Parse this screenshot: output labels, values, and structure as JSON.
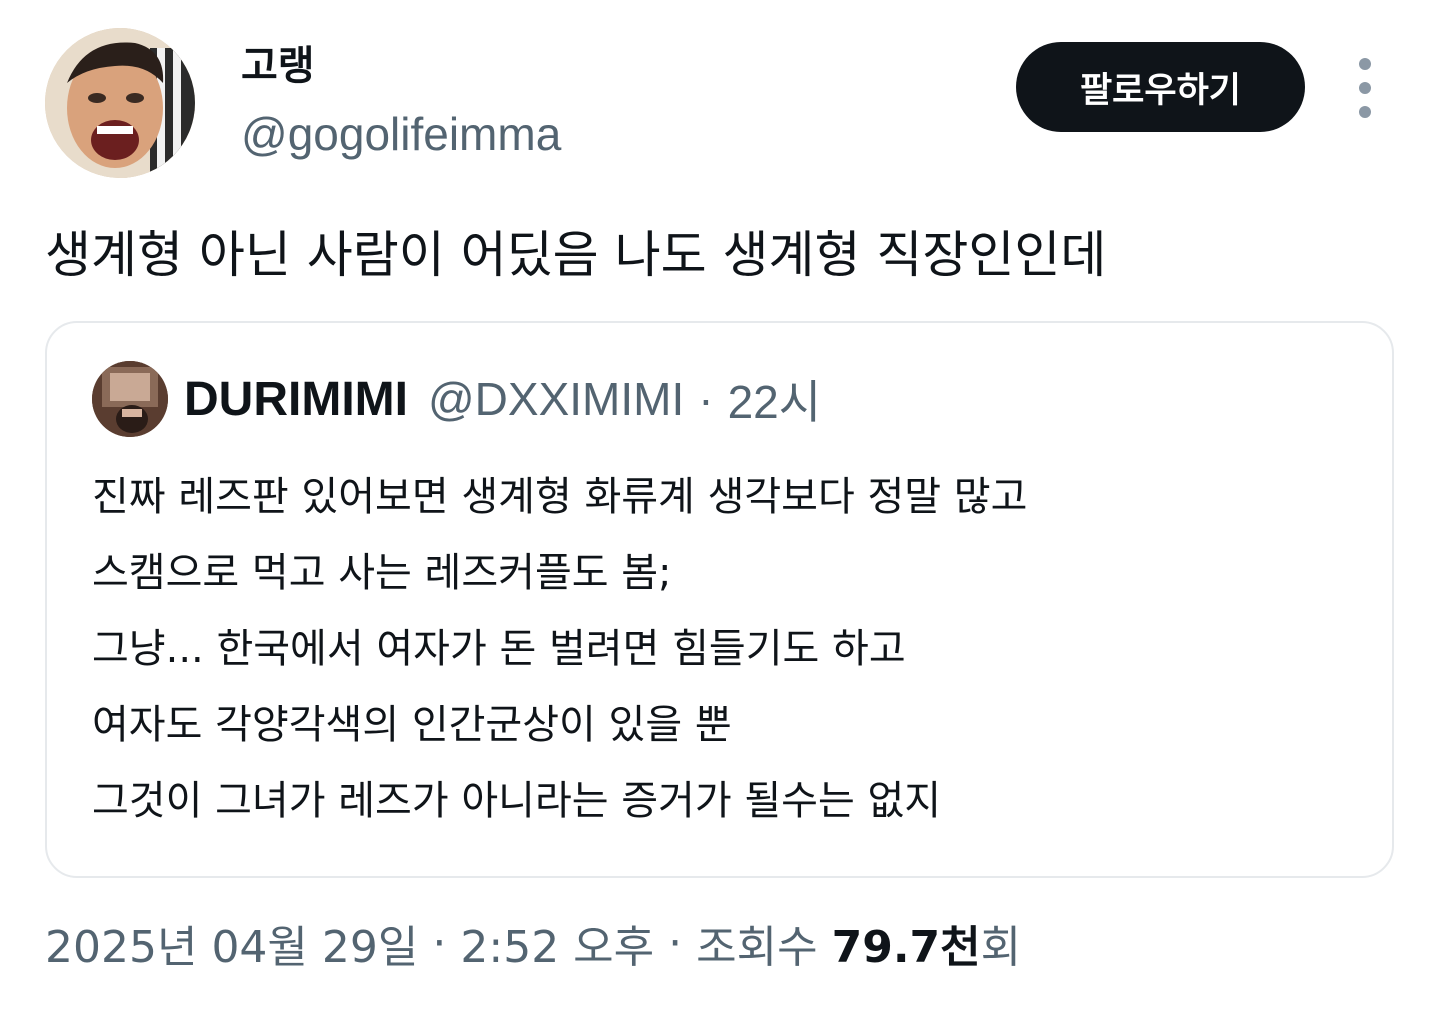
{
  "author": {
    "display_name": "고랭",
    "handle": "@gogolifeimma"
  },
  "follow_label": "팔로우하기",
  "tweet_text": "생계형 아닌 사람이 어딨음 나도 생계형 직장인인데",
  "quote": {
    "name": "DURIMIMI",
    "handle": "@DXXIMIMI",
    "separator": "·",
    "time": "22시",
    "lines": [
      "진짜 레즈판 있어보면 생계형 화류계 생각보다 정말 많고",
      "스캠으로 먹고 사는 레즈커플도 봄;",
      "그냥... 한국에서 여자가 돈 벌려면 힘들기도 하고",
      "여자도 각양각색의 인간군상이 있을 뿐",
      "그것이 그녀가 레즈가 아니라는 증거가 될수는 없지"
    ]
  },
  "meta": {
    "date": "2025년 04월 29일",
    "separator": "·",
    "time": "2:52 오후",
    "views_label": "조회수",
    "views_count": "79.7천",
    "views_suffix": "회"
  },
  "colors": {
    "text_primary": "#0f1419",
    "text_secondary": "#536471",
    "button_bg": "#0f1419",
    "border": "#e6e9ec"
  }
}
